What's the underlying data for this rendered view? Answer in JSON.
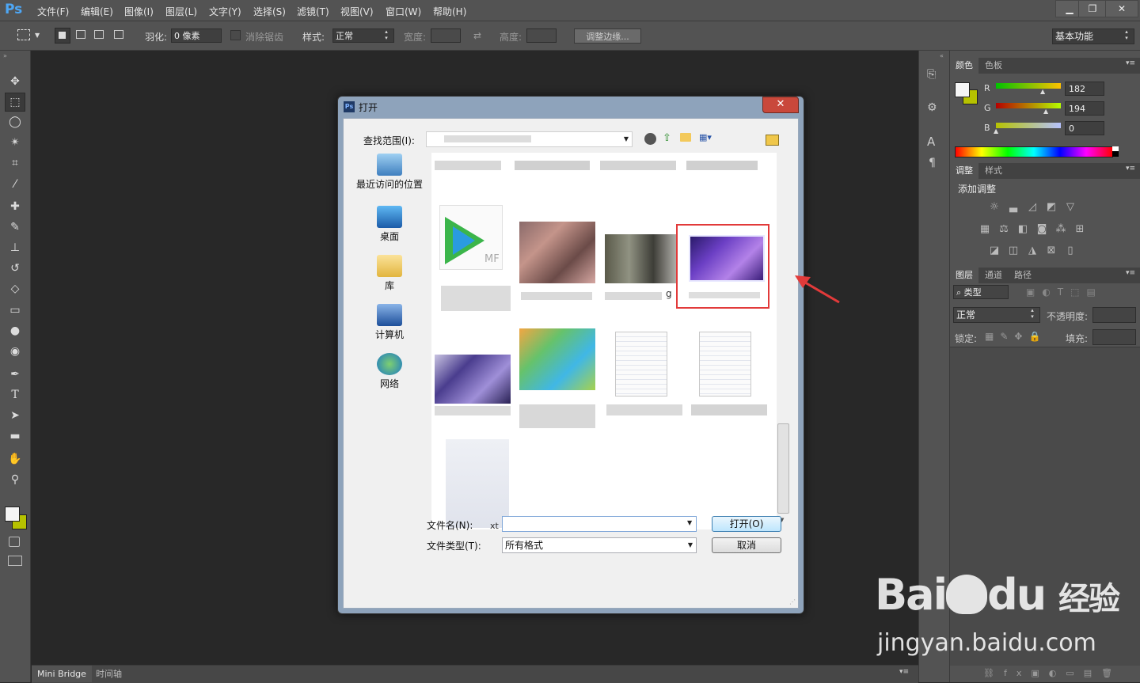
{
  "app": {
    "logo": "Ps",
    "menu": [
      "文件(F)",
      "编辑(E)",
      "图像(I)",
      "图层(L)",
      "文字(Y)",
      "选择(S)",
      "滤镜(T)",
      "视图(V)",
      "窗口(W)",
      "帮助(H)"
    ],
    "window_controls": {
      "minimize": "▁",
      "restore": "❐",
      "close": "✕"
    }
  },
  "options_bar": {
    "feather_label": "羽化:",
    "feather_value": "0 像素",
    "antialias_label": "消除锯齿",
    "style_label": "样式:",
    "style_value": "正常",
    "width_label": "宽度:",
    "height_label": "高度:",
    "refine_edge": "调整边缘...",
    "workspace": "基本功能"
  },
  "tools": [
    "move-tool-icon",
    "marquee-tool-icon",
    "lasso-tool-icon",
    "magic-wand-icon",
    "crop-tool-icon",
    "eyedropper-icon",
    "healing-brush-icon",
    "brush-icon",
    "stamp-icon",
    "history-brush-icon",
    "eraser-icon",
    "gradient-icon",
    "blur-icon",
    "dodge-icon",
    "pen-icon",
    "type-icon",
    "path-select-icon",
    "rectangle-icon",
    "hand-icon",
    "zoom-icon"
  ],
  "panels": {
    "color_tabs": [
      "颜色",
      "色板"
    ],
    "rgb": {
      "r_label": "R",
      "g_label": "G",
      "b_label": "B",
      "r": "182",
      "g": "194",
      "b": "0"
    },
    "adjust_tabs": [
      "调整",
      "样式"
    ],
    "add_adjustment": "添加调整",
    "layers_tabs": [
      "图层",
      "通道",
      "路径"
    ],
    "kind": "类型",
    "blend_mode": "正常",
    "opacity_label": "不透明度:",
    "lock_label": "锁定:",
    "fill_label": "填充:"
  },
  "bottom_tabs": [
    "Mini Bridge",
    "时间轴"
  ],
  "dialog": {
    "title": "打开",
    "look_in_label": "查找范围(I):",
    "places": [
      "最近访问的位置",
      "桌面",
      "库",
      "计算机",
      "网络"
    ],
    "filename_label": "文件名(N):",
    "filename_value": "",
    "filetype_label": "文件类型(T):",
    "filetype_value": "所有格式",
    "open_button": "打开(O)",
    "cancel_button": "取消",
    "file_fragment_1": "MF",
    "file_fragment_2": "g",
    "file_fragment_3": "xt"
  },
  "watermark": {
    "brand": "Bai",
    "brand2": "du",
    "cn": "经验",
    "url": "jingyan.baidu.com"
  },
  "colors": {
    "highlight": "#e23a3a",
    "foreground": "#f5f5f5",
    "background": "#b6c200"
  }
}
